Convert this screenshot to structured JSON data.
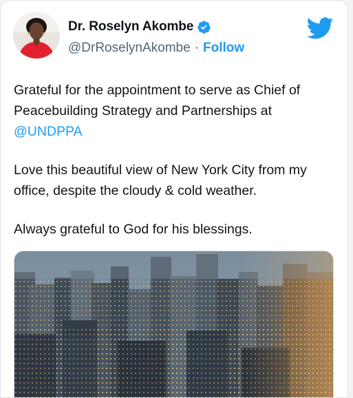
{
  "tweet": {
    "author": {
      "display_name": "Dr. Roselyn Akombe",
      "handle": "@DrRoselynAkombe",
      "verified": true,
      "separator": "·",
      "follow_label": "Follow"
    },
    "paragraph1": {
      "text": "Grateful for the appointment to serve as Chief of Peacebuilding Strategy and Partnerships at",
      "mention": "@UNDPPA"
    },
    "paragraph2": "Love this beautiful view of New York City from my office, despite the cloudy & cold weather.",
    "paragraph3": "Always grateful to God for his blessings.",
    "colors": {
      "accent": "#1d9bf0",
      "text": "#0f1419",
      "secondary": "#536471"
    },
    "icons": {
      "platform": "twitter-bird-icon",
      "verified": "verified-badge-icon"
    }
  }
}
